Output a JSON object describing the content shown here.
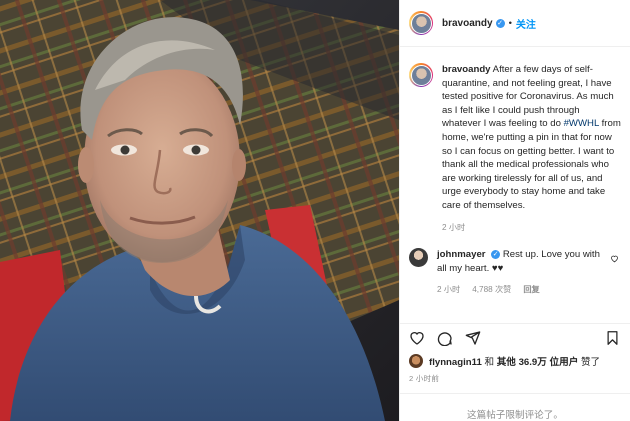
{
  "post": {
    "username": "bravoandy",
    "verified_icon": "verified-check-icon",
    "follow_label": "关注",
    "caption_prefix": "After a few days of self-quarantine, and not feeling great, I have tested positive for Coronavirus.  As much as I felt like I could push through whatever I was feeling to do ",
    "hashtag": "#WWHL",
    "caption_suffix": " from home, we're putting a pin in that for now so I can focus on getting better.  I want to thank all the medical professionals who are working tirelessly for all of us, and urge everybody to stay home and take care of themselves.",
    "caption_time": "2 小时",
    "likes_user": "flynnagin11",
    "likes_and": "和",
    "likes_others": "其他 36.9万 位用户",
    "likes_suffix": "赞了",
    "post_time": "2 小时前",
    "comments_disabled": "这篇帖子限制评论了。"
  },
  "comment": {
    "username": "johnmayer",
    "text": "Rest up. Love you with all my heart. ♥♥",
    "time": "2 小时",
    "likes": "4,788 次赞",
    "reply_label": "回复"
  },
  "icons": {
    "like": "heart-icon",
    "comment": "comment-icon",
    "share": "share-icon",
    "save": "bookmark-icon"
  },
  "colors": {
    "link_blue": "#0095f6",
    "verified_blue": "#3897f0",
    "meta_gray": "#8e8e8e"
  }
}
